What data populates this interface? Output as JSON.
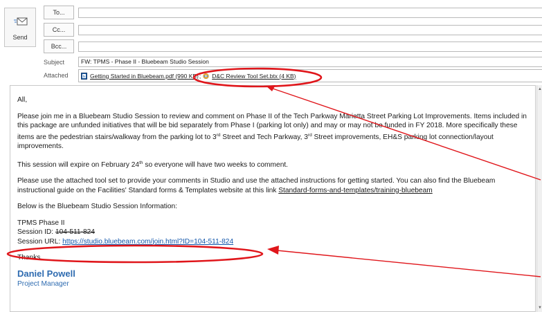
{
  "compose": {
    "send_label": "Send",
    "to_label": "To...",
    "cc_label": "Cc...",
    "bcc_label": "Bcc...",
    "subject_label": "Subject",
    "attached_label": "Attached",
    "subject_value": "FW: TPMS - Phase II - Bluebeam Studio Session",
    "attachments": [
      {
        "name": "Getting Started in Bluebeam.pdf (990 KB)",
        "icon": "pdf-icon"
      },
      {
        "name": "D&C Review Tool Set.btx (4 KB)",
        "icon": "bluebeam-toolset-icon"
      }
    ],
    "attachment_separator": ";"
  },
  "body": {
    "greeting": "All,",
    "p1_a": "Please join me in a Bluebeam Studio Session to review and comment on Phase II of the Tech Parkway Marietta Street Parking Lot Improvements.  Items included in this package are unfunded initiatives that will be bid separately from Phase I (parking lot only) and may or may not be funded in FY 2018.  More specifically these items are the pedestrian stairs/walkway from the parking lot to 3",
    "p1_sup1": "rd",
    "p1_b": " Street and Tech Parkway, 3",
    "p1_sup2": "rd",
    "p1_c": " Street improvements, EH&S parking lot connection/layout improvements.",
    "p2_a": "This session will expire on February 24",
    "p2_sup": "th",
    "p2_b": " so everyone will have two weeks to comment.",
    "p3_a": "Please use the attached tool set to provide your comments in Studio and use the attached instructions for getting started.  You can also find the Bluebeam instructional guide on the Facilities' Standard forms & Templates website at this link ",
    "p3_link": "Standard-forms-and-templates/training-bluebeam",
    "p4": "Below is the Bluebeam Studio Session Information:",
    "session_name": "TPMS Phase II",
    "session_id_label": "Session ID: ",
    "session_id": "104-511-824",
    "session_url_label": "Session URL: ",
    "session_url": "https://studio.bluebeam.com/join.html?ID=104-511-824",
    "thanks": "Thanks,",
    "sig_name": "Daniel Powell",
    "sig_title": "Project Manager"
  },
  "colors": {
    "annotation": "#e0161b",
    "link": "#1155aa",
    "signature": "#2e6bb0"
  }
}
